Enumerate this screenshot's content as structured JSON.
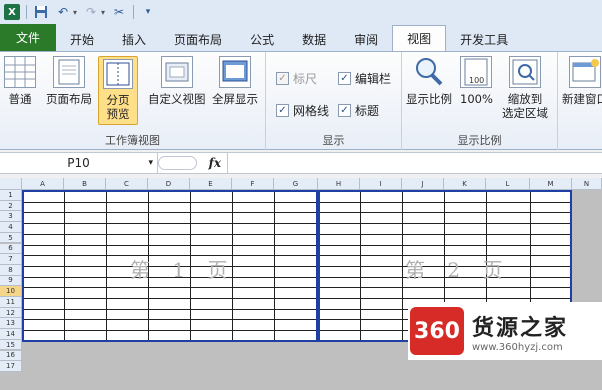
{
  "qat": {
    "app_icon": "excel-icon",
    "icons": [
      "save-icon",
      "undo-icon",
      "redo-icon",
      "tool-icon",
      "customize-qat-icon"
    ]
  },
  "tabs": [
    "文件",
    "开始",
    "插入",
    "页面布局",
    "公式",
    "数据",
    "审阅",
    "视图",
    "开发工具"
  ],
  "active_tab": "视图",
  "ribbon": {
    "workbook_views": {
      "label": "工作簿视图",
      "buttons": [
        "普通",
        "页面布局",
        "分页\n预览",
        "自定义视图",
        "全屏显示"
      ],
      "selected": "分页\n预览"
    },
    "show": {
      "label": "显示",
      "checks": [
        {
          "label": "标尺",
          "checked": true,
          "disabled": true
        },
        {
          "label": "编辑栏",
          "checked": true,
          "disabled": false
        },
        {
          "label": "网格线",
          "checked": true,
          "disabled": false
        },
        {
          "label": "标题",
          "checked": true,
          "disabled": false
        }
      ]
    },
    "zoom": {
      "label": "显示比例",
      "buttons": [
        "显示比例",
        "100%",
        "缩放到\n选定区域"
      ]
    },
    "window": {
      "buttons": [
        "新建窗口"
      ]
    }
  },
  "formula_bar": {
    "name_box": "P10",
    "fx": "fx",
    "content": ""
  },
  "sheet": {
    "columns": [
      "A",
      "B",
      "C",
      "D",
      "E",
      "F",
      "G",
      "H",
      "I",
      "J",
      "K",
      "L",
      "M",
      "N"
    ],
    "rows": [
      "1",
      "2",
      "3",
      "4",
      "5",
      "6",
      "7",
      "8",
      "9",
      "10",
      "11",
      "12",
      "13",
      "14",
      "15",
      "16",
      "17"
    ],
    "active_row": "10",
    "page_labels": [
      "第 1 页",
      "第 2 页"
    ]
  },
  "watermark": {
    "logo": "360",
    "title": "货源之家",
    "url": "www.360hyzj.com"
  },
  "colors": {
    "file_tab": "#2a7a2a",
    "page_border": "#1f3fa5",
    "selected_button": "#ffdf88",
    "watermark_logo": "#d62b26"
  }
}
